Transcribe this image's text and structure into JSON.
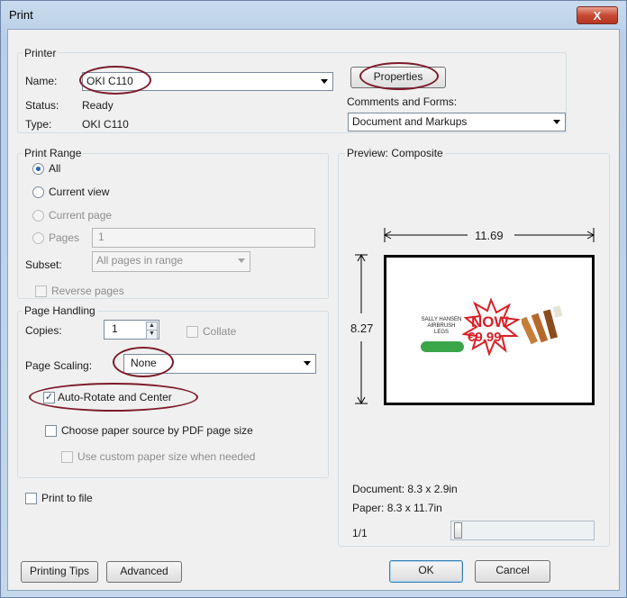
{
  "window": {
    "title": "Print",
    "close_symbol": "X"
  },
  "printer": {
    "group_label": "Printer",
    "name_label": "Name:",
    "name_value": "OKI C110",
    "status_label": "Status:",
    "status_value": "Ready",
    "type_label": "Type:",
    "type_value": "OKI C110",
    "properties_button": "Properties",
    "comments_label": "Comments and Forms:",
    "comments_value": "Document and Markups"
  },
  "print_range": {
    "group_label": "Print Range",
    "all": "All",
    "current_view": "Current view",
    "current_page": "Current page",
    "pages": "Pages",
    "pages_value": "1",
    "subset_label": "Subset:",
    "subset_value": "All pages in range",
    "reverse_pages": "Reverse pages"
  },
  "page_handling": {
    "group_label": "Page Handling",
    "copies_label": "Copies:",
    "copies_value": "1",
    "collate": "Collate",
    "page_scaling_label": "Page Scaling:",
    "page_scaling_value": "None",
    "auto_rotate": "Auto-Rotate and Center",
    "choose_paper_source": "Choose paper source by PDF page size",
    "custom_paper_size": "Use custom paper size when needed"
  },
  "print_to_file": "Print to file",
  "preview": {
    "label": "Preview: Composite",
    "width_dim": "11.69",
    "height_dim": "8.27",
    "document_size": "Document: 8.3 x 2.9in",
    "paper_size": "Paper: 8.3 x 11.7in",
    "page_indicator": "1/1",
    "ad": {
      "brand_line1": "SALLY HANSEN",
      "brand_line2": "AIRBRUSH",
      "brand_line3": "LEGS",
      "now": "NOW",
      "price": "€9,99"
    }
  },
  "buttons": {
    "printing_tips": "Printing Tips",
    "advanced": "Advanced",
    "ok": "OK",
    "cancel": "Cancel"
  }
}
